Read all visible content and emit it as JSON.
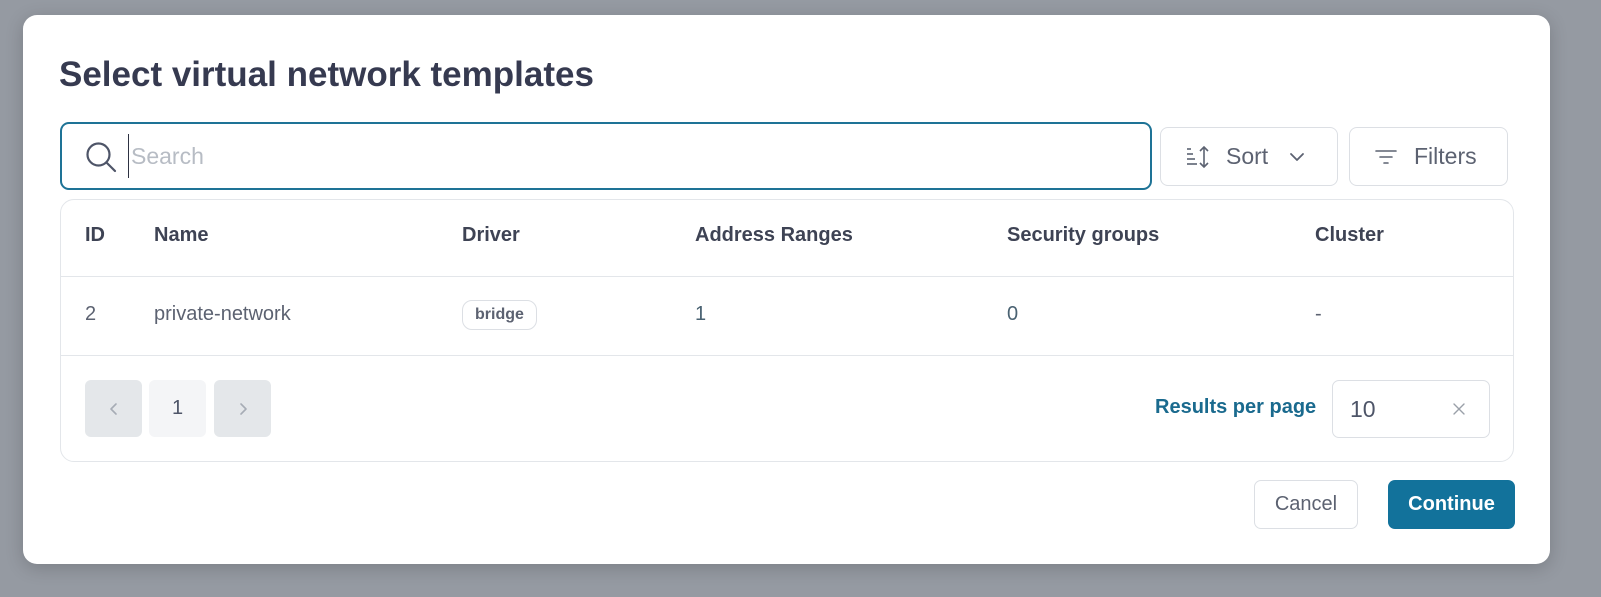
{
  "dialog": {
    "title": "Select virtual network templates"
  },
  "toolbar": {
    "search_placeholder": "Search",
    "search_value": "",
    "search_icon": "search-icon",
    "sort_label": "Sort",
    "sort_icon": "sort-icon",
    "sort_chevron_icon": "chevron-down-icon",
    "filters_label": "Filters",
    "filters_icon": "filter-icon",
    "accent_color": "#1e7396"
  },
  "table": {
    "columns": [
      "ID",
      "Name",
      "Driver",
      "Address Ranges",
      "Security groups",
      "Cluster"
    ],
    "rows": [
      {
        "id": "2",
        "name": "private-network",
        "driver": "bridge",
        "address_ranges": "1",
        "security_groups": "0",
        "cluster": "-"
      }
    ]
  },
  "pagination": {
    "prev_icon": "chevron-left-icon",
    "current_page": "1",
    "next_icon": "chevron-right-icon",
    "results_per_page_label": "Results per page",
    "results_per_page_value": "10",
    "clear_icon": "close-icon"
  },
  "footer": {
    "cancel_label": "Cancel",
    "continue_label": "Continue",
    "primary_color": "#12729b"
  }
}
